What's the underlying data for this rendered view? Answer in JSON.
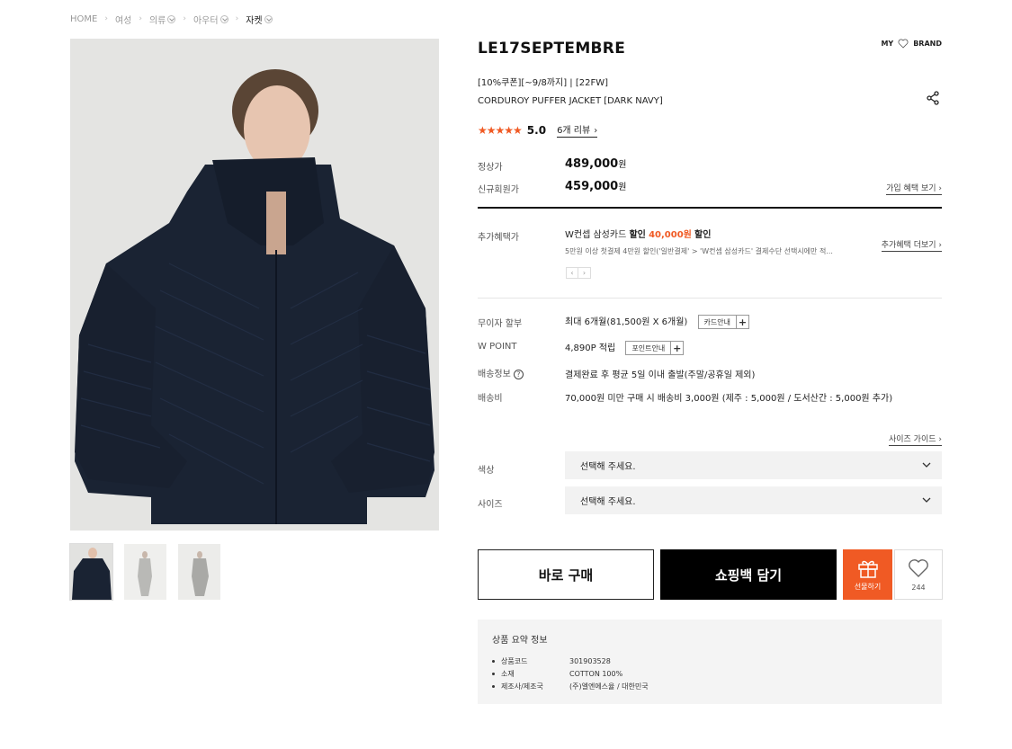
{
  "breadcrumb": [
    "HOME",
    "여성",
    "의류",
    "아우터",
    "자켓"
  ],
  "product": {
    "brand": "LE17SEPTEMBRE",
    "promo": "[10%쿠폰][~9/8까지] | [22FW]",
    "name": "CORDUROY PUFFER JACKET [DARK NAVY]",
    "stars": "★★★★★",
    "rating": "5.0",
    "reviews": "6개 리뷰",
    "reviews_arrow": "›"
  },
  "header_links": {
    "my": "MY",
    "brand": "BRAND"
  },
  "price": {
    "regular_label": "정상가",
    "regular_value": "489,000",
    "member_label": "신규회원가",
    "member_value": "459,000",
    "currency": "원",
    "join_link": "가입 혜택 보기 ›"
  },
  "benefit": {
    "label": "추가혜택가",
    "title_prefix": "W컨셉 삼성카드",
    "title_bold": "할인",
    "title_amount": "40,000원",
    "title_suffix": "할인",
    "desc": "5만원 이상 첫결제 4만원 할인('일반결제' > 'W컨셉 삼성카드' 결제수단 선택시에만 적...",
    "more_link": "추가혜택 더보기 ›",
    "prev": "‹",
    "next": "›"
  },
  "info": {
    "installment_label": "무이자 할부",
    "installment_value": "최대 6개월(81,500원 X 6개월)",
    "card_guide": "카드안내",
    "point_label": "W POINT",
    "point_value": "4,890P 적립",
    "point_guide": "포인트안내",
    "shipping_label": "배송정보",
    "shipping_value": "결제완료 후 평균 5일 이내 출발(주말/공휴일 제외)",
    "fee_label": "배송비",
    "fee_value": "70,000원 미만 구매 시 배송비 3,000원 (제주 : 5,000원 / 도서산간 : 5,000원 추가)",
    "plus": "+",
    "qmark": "?"
  },
  "options": {
    "size_guide": "사이즈 가이드 ›",
    "color_label": "색상",
    "color_placeholder": "선택해 주세요.",
    "size_label": "사이즈",
    "size_placeholder": "선택해 주세요."
  },
  "actions": {
    "buy": "바로 구매",
    "cart": "쇼핑백 담기",
    "gift": "선물하기",
    "like_count": "244"
  },
  "summary": {
    "title": "상품 요약 정보",
    "rows": [
      {
        "k": "상품코드",
        "v": "301903528"
      },
      {
        "k": "소재",
        "v": "COTTON 100%"
      },
      {
        "k": "제조사/제조국",
        "v": "(주)엘엔에스율 / 대한민국"
      }
    ]
  },
  "colors": {
    "accent": "#f05a24",
    "jacket": "#1a2333"
  }
}
